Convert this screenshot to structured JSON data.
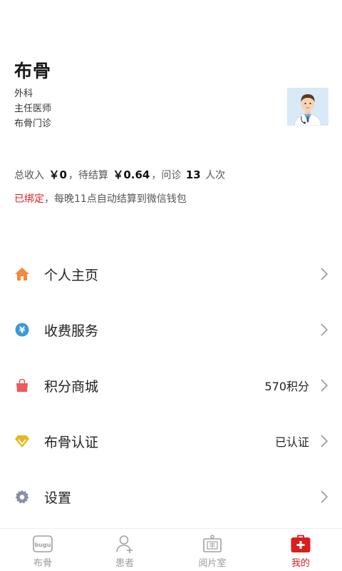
{
  "profile": {
    "name": "布骨",
    "department": "外科",
    "title": "主任医师",
    "clinic": "布骨门诊"
  },
  "stats": {
    "income_label": "总收入",
    "income_value": "￥0",
    "sep1": "，待结算",
    "pending_value": "￥0.64",
    "sep2": "，问诊",
    "consult_count": "13",
    "consult_unit": "人次"
  },
  "binding": {
    "status": "已绑定",
    "note": "，每晚11点自动结算到微信钱包"
  },
  "menu": [
    {
      "label": "个人主页",
      "value": "",
      "icon": "home-icon",
      "color": "#f5883a"
    },
    {
      "label": "收费服务",
      "value": "",
      "icon": "yuan-icon",
      "color": "#3a9ad9"
    },
    {
      "label": "积分商城",
      "value": "570积分",
      "icon": "shopping-bag-icon",
      "color": "#ee5a5a"
    },
    {
      "label": "布骨认证",
      "value": "已认证",
      "icon": "diamond-icon",
      "color": "#e8b61c"
    },
    {
      "label": "设置",
      "value": "",
      "icon": "gear-icon",
      "color": "#8a8fa8"
    }
  ],
  "tabs": [
    {
      "label": "布骨",
      "icon": "bugu-logo-icon",
      "active": false
    },
    {
      "label": "患者",
      "icon": "add-user-icon",
      "active": false
    },
    {
      "label": "阅片室",
      "icon": "xray-viewer-icon",
      "active": false
    },
    {
      "label": "我的",
      "icon": "medical-kit-icon",
      "active": true
    }
  ],
  "colors": {
    "accent_red": "#d81e1e",
    "inactive_tab": "#9a9a9a"
  }
}
